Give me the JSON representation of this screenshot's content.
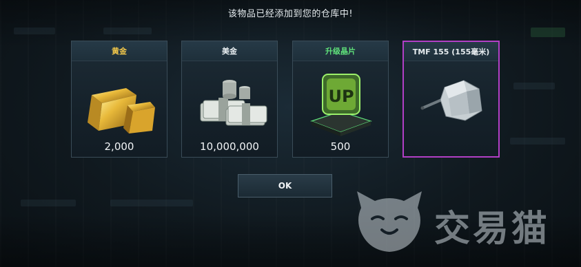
{
  "dialog": {
    "title": "该物品已经添加到您的仓库中!",
    "ok_label": "OK"
  },
  "rewards": [
    {
      "name": "黄金",
      "amount": "2,000",
      "name_color": "#f0c64a",
      "icon": "gold-bars-icon",
      "selected": false
    },
    {
      "name": "美金",
      "amount": "10,000,000",
      "name_color": "#e6ecef",
      "icon": "cash-stacks-icon",
      "selected": false
    },
    {
      "name": "升级晶片",
      "amount": "500",
      "name_color": "#5fe07a",
      "icon": "upgrade-chip-icon",
      "selected": false
    },
    {
      "name": "TMF 155 (155毫米)",
      "amount": "",
      "name_color": "#e6ecef",
      "icon": "turret-gun-icon",
      "selected": true
    }
  ],
  "watermark": {
    "text": "交易猫",
    "icon": "cat-logo-icon"
  },
  "colors": {
    "selected_border": "#b23fc6"
  }
}
